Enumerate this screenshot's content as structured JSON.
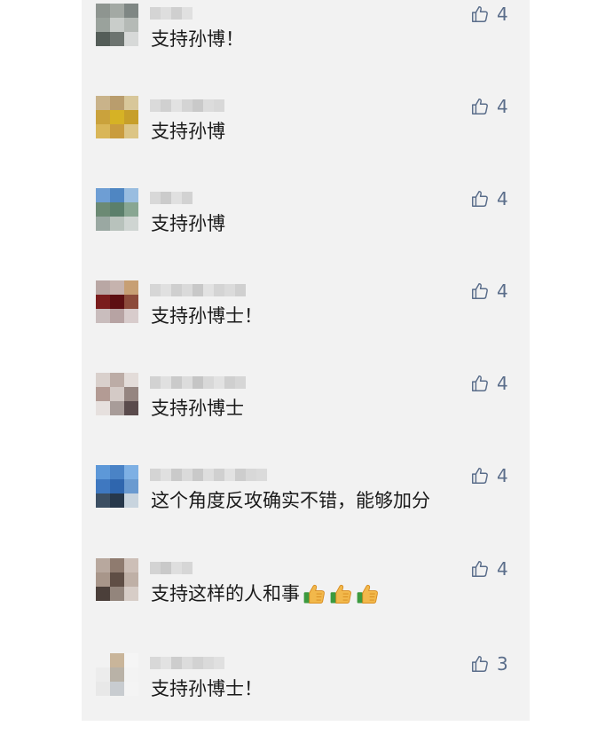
{
  "comments": [
    {
      "text": "支持孙博！",
      "likes": "4",
      "avatar_colors": [
        "#8e9590",
        "#a3a9a4",
        "#7f8784",
        "#9aa29c",
        "#c9cdca",
        "#b5bab6",
        "#545d58",
        "#6d7470",
        "#d7d9d8"
      ],
      "name_colors": [
        "#d4d4d4",
        "#dedede",
        "#cfcfcf",
        "#e0e0e0"
      ]
    },
    {
      "text": "支持孙博",
      "likes": "4",
      "avatar_colors": [
        "#c9b38a",
        "#b99d6d",
        "#d8c79a",
        "#caa23c",
        "#d6b225",
        "#c79f2a",
        "#d9b658",
        "#c99c3e",
        "#dcc585"
      ],
      "name_colors": [
        "#dadada",
        "#d0d0d0",
        "#e2e2e2",
        "#d4d4d4",
        "#c9c9c9",
        "#dcdcdc",
        "#d8d8d8"
      ]
    },
    {
      "text": "支持孙博",
      "likes": "4",
      "avatar_colors": [
        "#6e9ed4",
        "#4f86c2",
        "#99bde0",
        "#6c8a74",
        "#5b7f6b",
        "#88a692",
        "#9aa8a2",
        "#b8c2bc",
        "#cfd5d2"
      ],
      "name_colors": [
        "#d8d8d8",
        "#cbcbcb",
        "#e0e0e0",
        "#d2d2d2"
      ]
    },
    {
      "text": "支持孙博士！",
      "likes": "4",
      "avatar_colors": [
        "#b9a7a4",
        "#c6b3ae",
        "#c79f74",
        "#7a1c1c",
        "#5d0f12",
        "#8c4b3b",
        "#c9bdbd",
        "#b7a3a3",
        "#d8cccc"
      ],
      "name_colors": [
        "#d6d6d6",
        "#e0e0e0",
        "#cfcfcf",
        "#dadada",
        "#c8c8c8",
        "#e2e2e2",
        "#d4d4d4",
        "#dbdbdb",
        "#d0d0d0"
      ]
    },
    {
      "text": "支持孙博士",
      "likes": "4",
      "avatar_colors": [
        "#d9d0cc",
        "#bcaca6",
        "#e3dcd9",
        "#b39b94",
        "#d4cac6",
        "#958580",
        "#e6e0de",
        "#a89c99",
        "#5a4b4c"
      ],
      "name_colors": [
        "#d2d2d2",
        "#e0e0e0",
        "#cacaca",
        "#dcdcdc",
        "#c5c5c5",
        "#d8d8d8",
        "#e2e2e2",
        "#cfcfcf",
        "#d6d6d6"
      ]
    },
    {
      "text": "这个角度反攻确实不错，能够加分",
      "likes": "4",
      "avatar_colors": [
        "#5d98d8",
        "#4a83c6",
        "#7eb0e4",
        "#3f78c0",
        "#2f66ae",
        "#6a9ad0",
        "#3c4f63",
        "#27384b",
        "#c8d4de"
      ],
      "name_colors": [
        "#d4d4d4",
        "#e0e0e0",
        "#cacaca",
        "#dadada",
        "#c9c9c9",
        "#dedede",
        "#d0d0d0",
        "#e2e2e2",
        "#cdcdcd",
        "#d8d8d8",
        "#dbdbdb"
      ]
    },
    {
      "text": "支持这样的人和事",
      "likes": "4",
      "avatar_colors": [
        "#b8a89e",
        "#8f7b6f",
        "#cdbfb7",
        "#a8968a",
        "#5f4e45",
        "#bfb0a6",
        "#4b3f3a",
        "#93857c",
        "#d7cdc7"
      ],
      "name_colors": [
        "#d3d3d3",
        "#c9c9c9",
        "#dedede",
        "#d6d6d6"
      ]
    },
    {
      "text": "支持孙博士！",
      "likes": "3",
      "avatar_colors": [
        "#f2f2f2",
        "#c9b59a",
        "#f5f5f5",
        "#ececec",
        "#b9b2a7",
        "#f3f3f3",
        "#e8e8e8",
        "#c8ccd0",
        "#f4f4f4"
      ],
      "name_colors": [
        "#d8d8d8",
        "#e2e2e2",
        "#cdcdcd",
        "#dcdcdc",
        "#d2d2d2",
        "#dadada",
        "#e0e0e0"
      ]
    }
  ],
  "emoji_icon": "thumbs-up-emoji",
  "like_icon": "thumbs-up-outline-icon",
  "colors": {
    "panel_bg": "#f2f2f2",
    "like_color": "#5a6d8a",
    "text_color": "#1a1a1a"
  }
}
